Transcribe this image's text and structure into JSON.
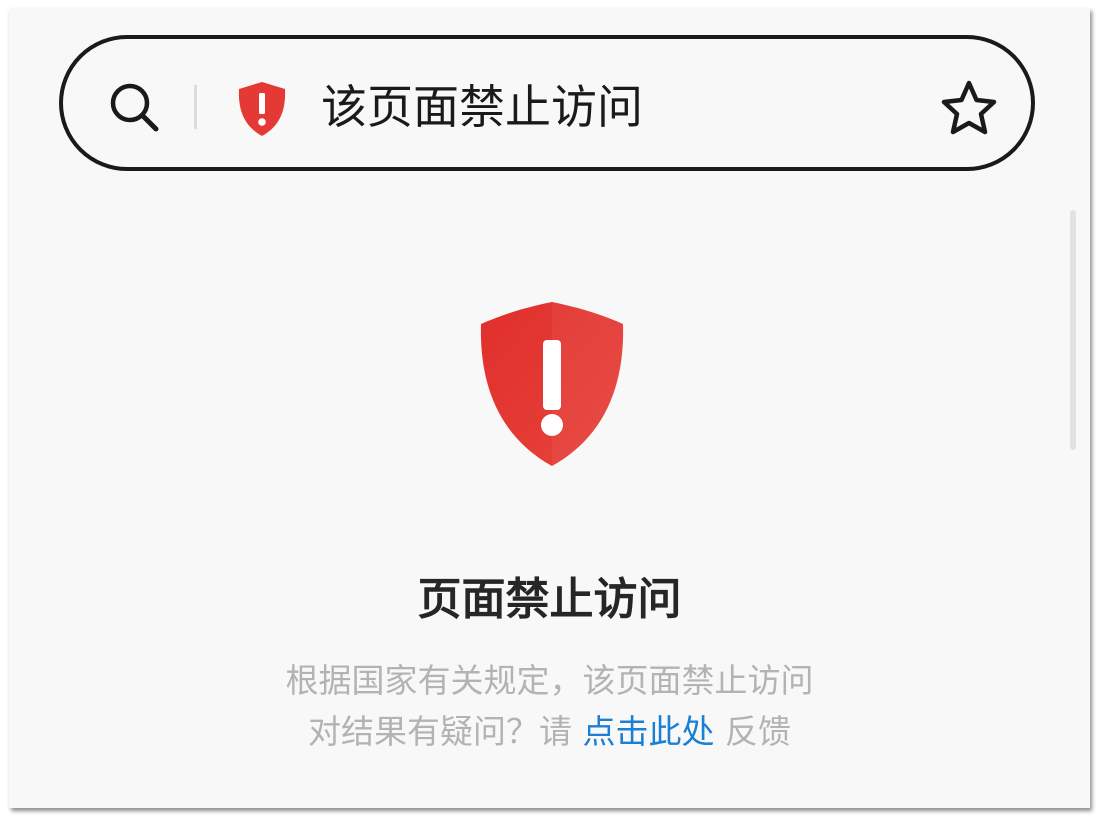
{
  "address_bar": {
    "page_status_text": "该页面禁止访问",
    "search_icon": "search-icon",
    "security_icon": "shield-exclamation-icon",
    "bookmark_icon": "star-icon"
  },
  "block_page": {
    "icon": "shield-exclamation-icon",
    "title": "页面禁止访问",
    "description_line1": "根据国家有关规定，该页面禁止访问",
    "question_prefix": "对结果有疑问？请",
    "feedback_link_text": "点击此处",
    "question_suffix": "反馈"
  },
  "colors": {
    "shield_red": "#e53935",
    "link_blue": "#1b7fd4",
    "background": "#f8f8f8",
    "muted_text": "#b3b3b3"
  }
}
